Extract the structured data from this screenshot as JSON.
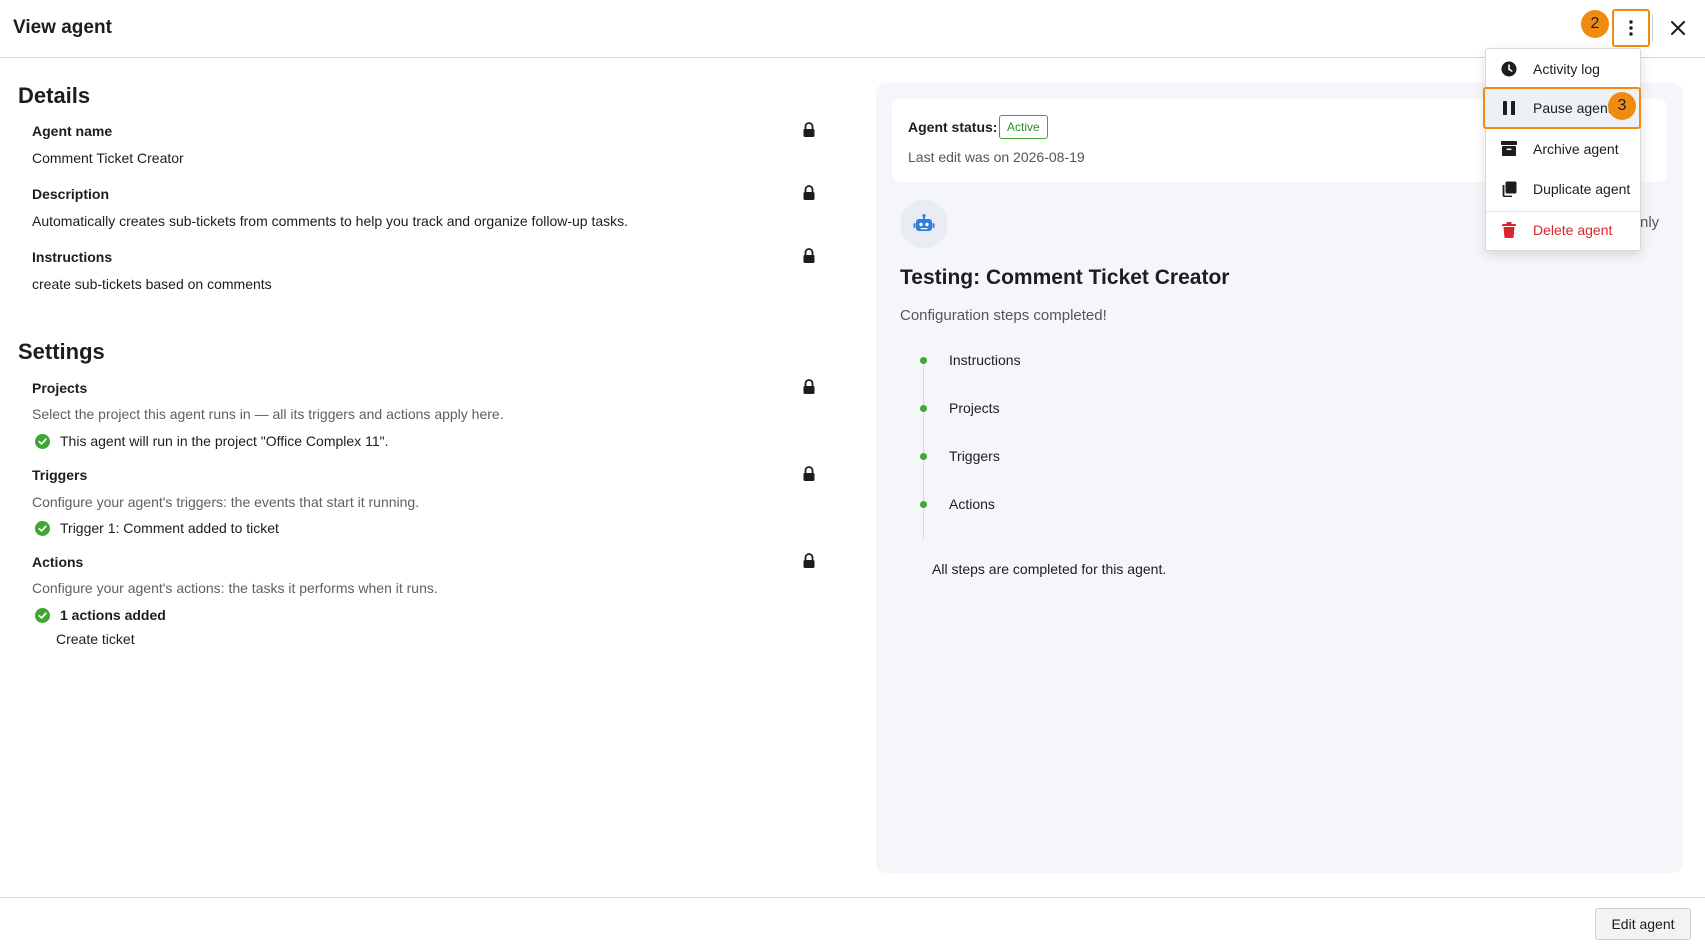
{
  "header": {
    "title": "View agent",
    "step_marker": "2",
    "more_options_icon": "kebab-vertical-icon",
    "close_icon": "close-icon"
  },
  "details": {
    "section_title": "Details",
    "agent_name_label": "Agent name",
    "agent_name_value": "Comment Ticket Creator",
    "description_label": "Description",
    "description_value": "Automatically creates sub-tickets from comments to help you track and organize follow-up tasks.",
    "instructions_label": "Instructions",
    "instructions_value": "create sub-tickets based on comments"
  },
  "settings": {
    "section_title": "Settings",
    "projects_label": "Projects",
    "projects_help": "Select the project this agent runs in — all its triggers and actions apply here.",
    "projects_status": "This agent will run in the project \"Office Complex 11\".",
    "triggers_label": "Triggers",
    "triggers_help": "Configure your agent's triggers: the events that start it running.",
    "triggers_status": "Trigger 1: Comment added to ticket",
    "actions_label": "Actions",
    "actions_help": "Configure your agent's actions: the tasks it performs when it runs.",
    "actions_status": "1 actions added",
    "actions_item": "Create ticket"
  },
  "status_panel": {
    "status_label": "Agent status:",
    "status_badge": "Active",
    "last_edit": "Last edit was on 2026-08-19",
    "clipped_text": "nly",
    "testing_title": "Testing: Comment Ticket Creator",
    "config_done": "Configuration steps completed!",
    "steps": [
      "Instructions",
      "Projects",
      "Triggers",
      "Actions"
    ],
    "all_steps": "All steps are completed for this agent."
  },
  "menu": {
    "step_marker": "3",
    "items": [
      {
        "label": "Activity log",
        "icon": "clock-icon"
      },
      {
        "label": "Pause agent",
        "icon": "pause-icon"
      },
      {
        "label": "Archive agent",
        "icon": "archive-icon"
      },
      {
        "label": "Duplicate agent",
        "icon": "duplicate-icon"
      },
      {
        "label": "Delete agent",
        "icon": "trash-icon"
      }
    ]
  },
  "footer": {
    "edit_button": "Edit agent"
  },
  "colors": {
    "highlight": "#ef8a13",
    "success": "#3fa535",
    "danger": "#d9262b",
    "panel_bg": "#f4f6f9"
  }
}
